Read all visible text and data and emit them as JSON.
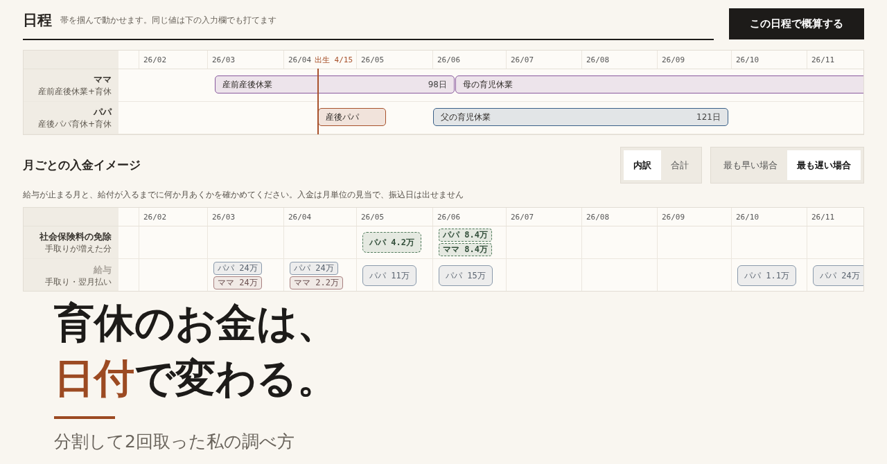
{
  "schedule": {
    "title": "日程",
    "hint": "帯を掴んで動かせます。同じ値は下の入力欄でも打てます",
    "button": "この日程で概算する",
    "months": [
      "26/02",
      "26/03",
      "26/04",
      "26/05",
      "26/06",
      "26/07",
      "26/08",
      "26/09",
      "26/10",
      "26/11"
    ],
    "birth_marker": "出生 4/15",
    "rows": [
      {
        "name": "ママ",
        "sub": "産前産後休業+育休",
        "bars": [
          {
            "label": "産前産後休業",
            "days": "98日",
            "color": "#8a5a9e"
          },
          {
            "label": "母の育児休業",
            "color": "#8a5a9e"
          }
        ]
      },
      {
        "name": "パパ",
        "sub": "産後パパ育休+育休",
        "bars": [
          {
            "label": "産後パパ",
            "color": "#a8522c"
          },
          {
            "label": "父の育児休業",
            "days": "121日",
            "color": "#3a6088"
          }
        ]
      }
    ]
  },
  "income": {
    "title": "月ごとの入金イメージ",
    "toggles": [
      [
        {
          "label": "内訳",
          "selected": true
        },
        {
          "label": "合計",
          "selected": false
        }
      ],
      [
        {
          "label": "最も早い場合",
          "selected": false
        },
        {
          "label": "最も遅い場合",
          "selected": true
        }
      ]
    ],
    "note": "給与が止まる月と、給付が入るまでに何か月あくかを確かめてください。入金は月単位の見当で、振込日は出せません",
    "months": [
      "26/02",
      "26/03",
      "26/04",
      "26/05",
      "26/06",
      "26/07",
      "26/08",
      "26/09",
      "26/10",
      "26/11"
    ],
    "rows": [
      {
        "name": "社会保険料の免除",
        "sub": "手取りが増えた分",
        "kind": "exemption",
        "cells": [
          [],
          [],
          [],
          [
            {
              "label": "パパ 4.2万",
              "color": "#4f7a5a"
            }
          ],
          [
            {
              "label": "パパ 8.4万",
              "color": "#4f7a5a"
            },
            {
              "label": "ママ 8.4万",
              "color": "#4f7a5a"
            }
          ],
          [],
          [],
          [],
          [],
          []
        ]
      },
      {
        "name": "給与",
        "sub": "手取り・翌月払い",
        "kind": "salary",
        "cells": [
          [],
          [
            {
              "label": "パパ 24万",
              "color": "#8a9aac"
            },
            {
              "label": "ママ 24万",
              "color": "#a88080"
            }
          ],
          [
            {
              "label": "パパ 24万",
              "color": "#8a9aac"
            },
            {
              "label": "ママ 2.2万",
              "color": "#a88080"
            }
          ],
          [
            {
              "label": "パパ 11万",
              "color": "#8a9aac"
            }
          ],
          [
            {
              "label": "パパ 15万",
              "color": "#8a9aac"
            }
          ],
          [],
          [],
          [],
          [
            {
              "label": "パパ 1.1万",
              "color": "#8a9aac"
            }
          ],
          [
            {
              "label": "パパ 24万",
              "color": "#8a9aac"
            }
          ]
        ]
      }
    ]
  },
  "hero": {
    "lines": [
      [
        {
          "text": "育休のお金は、",
          "accent": false
        }
      ],
      [
        {
          "text": "日付",
          "accent": true
        },
        {
          "text": "で変わる。",
          "accent": false
        }
      ]
    ],
    "subtitle": "分割して2回取った私の調べ方"
  }
}
